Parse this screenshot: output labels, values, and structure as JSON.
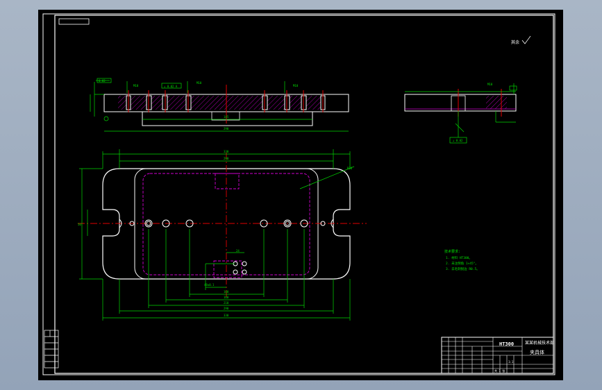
{
  "colors": {
    "background": "#000000",
    "frame": "#ffffff",
    "part_outline": "#ffffff",
    "dimension": "#00d800",
    "centerline": "#e00000",
    "hidden": "#d000d0",
    "hatch": "#d000d0",
    "workspace": "#9aaabb"
  },
  "notes": {
    "title": "技术要求:",
    "items": [
      "1. 材料 HT300。",
      "2. 未注倒角 1×45°。",
      "3. 去毛刺锐边 R0.5。"
    ]
  },
  "roughness": {
    "label": "其余"
  },
  "title_block": {
    "material": "HT300",
    "company": "某某机械技术部",
    "drawing_name": "夹具体",
    "scale": "1:1",
    "sheet_label": "共 1 张"
  },
  "left_table": [
    "",
    "",
    "",
    "",
    "",
    ""
  ]
}
